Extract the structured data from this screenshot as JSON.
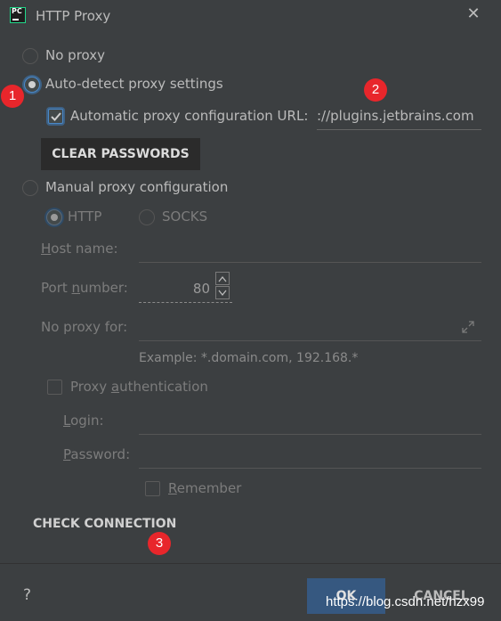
{
  "window": {
    "title": "HTTP Proxy",
    "app_icon_text": "PC"
  },
  "proxy_mode": {
    "no_proxy_label": "No proxy",
    "auto_detect_label": "Auto-detect proxy settings",
    "manual_label": "Manual proxy configuration",
    "selected": "auto-detect"
  },
  "auto": {
    "pac_checkbox_label": "Automatic proxy configuration URL:",
    "pac_checked": true,
    "pac_url_value": "://plugins.jetbrains.com",
    "clear_passwords_label": "CLEAR PASSWORDS"
  },
  "manual": {
    "http_label": "HTTP",
    "socks_label": "SOCKS",
    "host_label": "Host name:",
    "host_value": "",
    "port_label": "Port number:",
    "port_value": "80",
    "no_proxy_for_label": "No proxy for:",
    "no_proxy_for_value": "",
    "example_text": "Example: *.domain.com, 192.168.*",
    "auth_label": "Proxy authentication",
    "login_label": "Login:",
    "login_value": "",
    "password_label": "Password:",
    "password_value": "",
    "remember_label": "Remember"
  },
  "actions": {
    "check_connection_label": "CHECK CONNECTION",
    "help_label": "?",
    "ok_label": "OK",
    "cancel_label": "CANCEL"
  },
  "annotations": {
    "badge_1": "1",
    "badge_2": "2",
    "badge_3": "3"
  },
  "watermark": "https://blog.csdn.net/hzx99",
  "colors": {
    "background": "#3c3f41",
    "accent": "#4a88c7",
    "ok_button": "#365880",
    "badge": "#e8262b"
  },
  "icons": [
    "pycharm-app-icon",
    "close-icon",
    "checkmark-icon",
    "spinner-up-icon",
    "spinner-down-icon",
    "expand-icon",
    "help-icon"
  ]
}
